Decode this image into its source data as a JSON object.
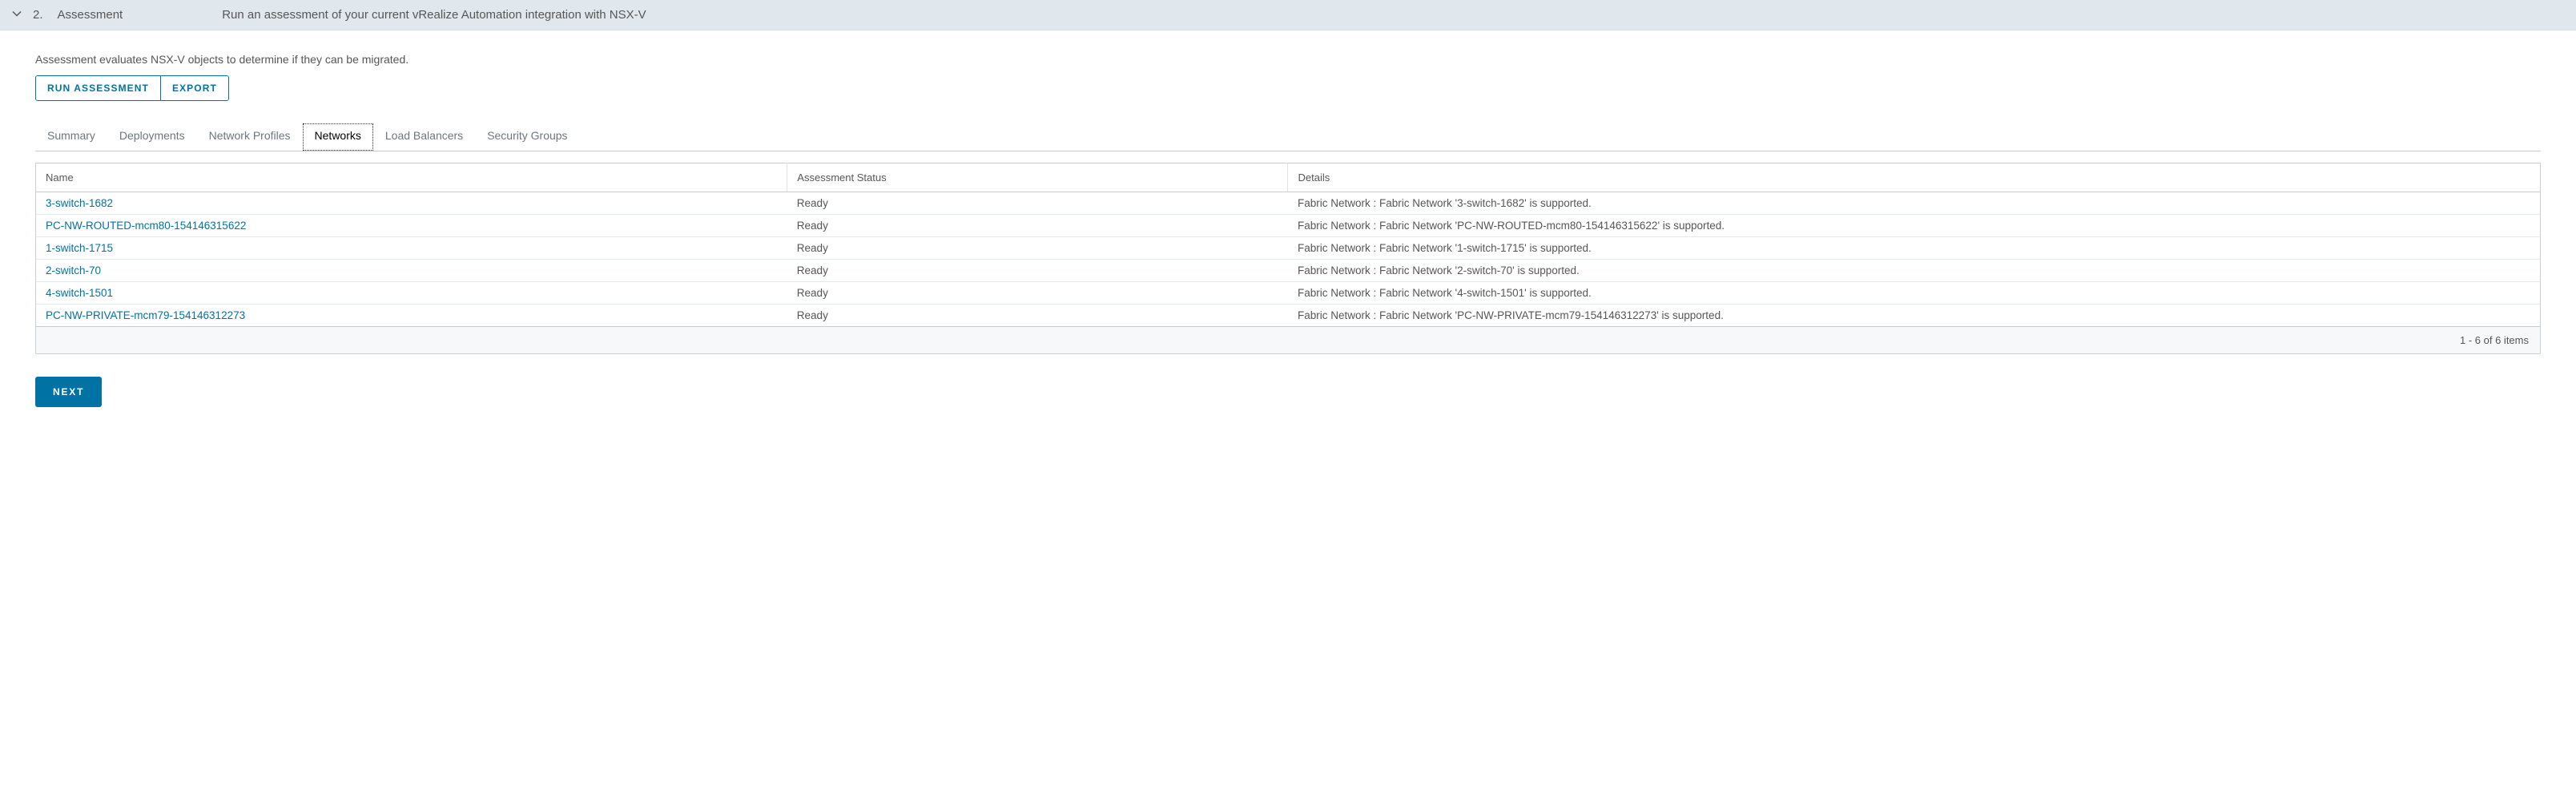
{
  "header": {
    "step_number": "2.",
    "step_title": "Assessment",
    "step_desc": "Run an assessment of your current vRealize Automation integration with NSX-V"
  },
  "intro": "Assessment evaluates NSX-V objects to determine if they can be migrated.",
  "buttons": {
    "run_assessment": "RUN ASSESSMENT",
    "export": "EXPORT",
    "next": "NEXT"
  },
  "tabs": [
    {
      "label": "Summary",
      "active": false
    },
    {
      "label": "Deployments",
      "active": false
    },
    {
      "label": "Network Profiles",
      "active": false
    },
    {
      "label": "Networks",
      "active": true
    },
    {
      "label": "Load Balancers",
      "active": false
    },
    {
      "label": "Security Groups",
      "active": false
    }
  ],
  "table": {
    "headers": {
      "name": "Name",
      "status": "Assessment Status",
      "details": "Details"
    },
    "rows": [
      {
        "name": "3-switch-1682",
        "status": "Ready",
        "details": "Fabric Network : Fabric Network '3-switch-1682' is supported."
      },
      {
        "name": "PC-NW-ROUTED-mcm80-154146315622",
        "status": "Ready",
        "details": "Fabric Network : Fabric Network 'PC-NW-ROUTED-mcm80-154146315622' is supported."
      },
      {
        "name": "1-switch-1715",
        "status": "Ready",
        "details": "Fabric Network : Fabric Network '1-switch-1715' is supported."
      },
      {
        "name": "2-switch-70",
        "status": "Ready",
        "details": "Fabric Network : Fabric Network '2-switch-70' is supported."
      },
      {
        "name": "4-switch-1501",
        "status": "Ready",
        "details": "Fabric Network : Fabric Network '4-switch-1501' is supported."
      },
      {
        "name": "PC-NW-PRIVATE-mcm79-154146312273",
        "status": "Ready",
        "details": "Fabric Network : Fabric Network 'PC-NW-PRIVATE-mcm79-154146312273' is supported."
      }
    ],
    "footer": "1 - 6 of 6 items"
  }
}
